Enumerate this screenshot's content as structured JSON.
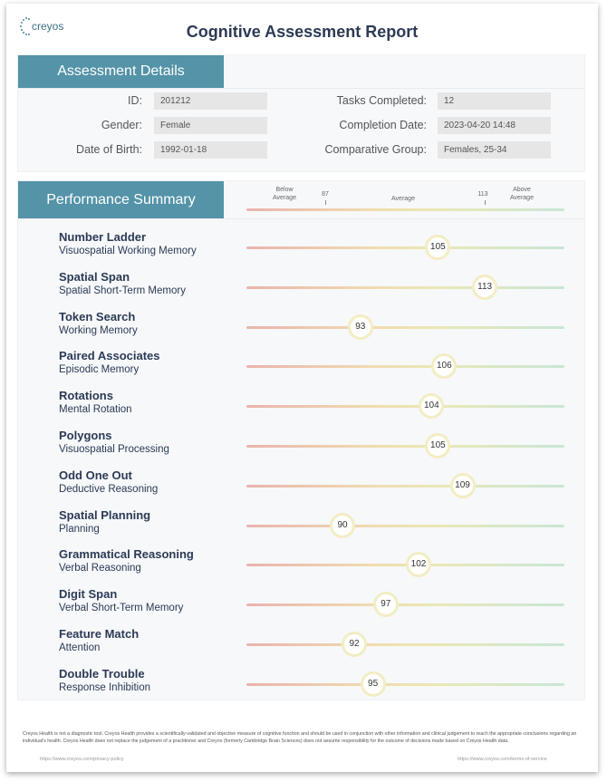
{
  "header": {
    "logo_text": "creyos",
    "title": "Cognitive Assessment Report"
  },
  "details": {
    "heading": "Assessment Details",
    "left": [
      {
        "label": "ID:",
        "value": "201212"
      },
      {
        "label": "Gender:",
        "value": "Female"
      },
      {
        "label": "Date of Birth:",
        "value": "1992-01-18"
      }
    ],
    "right": [
      {
        "label": "Tasks Completed:",
        "value": "12"
      },
      {
        "label": "Completion Date:",
        "value": "2023-04-20 14:48"
      },
      {
        "label": "Comparative Group:",
        "value": "Females, 25-34"
      }
    ]
  },
  "performance": {
    "heading": "Performance Summary",
    "scale": {
      "below": "Below Average",
      "average": "Average",
      "above": "Above Average",
      "low_cut": 87,
      "high_cut": 113,
      "low_cut_label": "87",
      "high_cut_label": "113"
    },
    "tasks": [
      {
        "name": "Number Ladder",
        "domain": "Visuospatial Working Memory",
        "score": 105,
        "score_label": "105"
      },
      {
        "name": "Spatial Span",
        "domain": "Spatial Short-Term Memory",
        "score": 113,
        "score_label": "113"
      },
      {
        "name": "Token Search",
        "domain": "Working Memory",
        "score": 93,
        "score_label": "93"
      },
      {
        "name": "Paired Associates",
        "domain": "Episodic Memory",
        "score": 106,
        "score_label": "106"
      },
      {
        "name": "Rotations",
        "domain": "Mental Rotation",
        "score": 104,
        "score_label": "104"
      },
      {
        "name": "Polygons",
        "domain": "Visuospatial Processing",
        "score": 105,
        "score_label": "105"
      },
      {
        "name": "Odd One Out",
        "domain": "Deductive Reasoning",
        "score": 109,
        "score_label": "109"
      },
      {
        "name": "Spatial Planning",
        "domain": "Planning",
        "score": 90,
        "score_label": "90"
      },
      {
        "name": "Grammatical Reasoning",
        "domain": "Verbal Reasoning",
        "score": 102,
        "score_label": "102"
      },
      {
        "name": "Digit Span",
        "domain": "Verbal Short-Term Memory",
        "score": 97,
        "score_label": "97"
      },
      {
        "name": "Feature Match",
        "domain": "Attention",
        "score": 92,
        "score_label": "92"
      },
      {
        "name": "Double Trouble",
        "domain": "Response Inhibition",
        "score": 95,
        "score_label": "95"
      }
    ]
  },
  "footer": {
    "disclaimer": "Creyos Health is not a diagnostic tool. Creyos Health provides a scientifically-validated and objective measure of cognitive function and should be used in conjunction with other information and clinical judgement to reach the appropriate conclusions regarding an individual's health. Creyos Health does not replace the judgement of a practitioner and Creyos (formerly Cambridge Brain Sciences) does not assume responsibility for the outcome of decisions made based on Creyos Health data.",
    "privacy_link": "https://www.creyos.com/privacy-policy",
    "terms_link": "https://www.creyos.com/terms-of-service"
  },
  "colors": {
    "accent": "#5493a8",
    "title": "#2c3a55"
  }
}
